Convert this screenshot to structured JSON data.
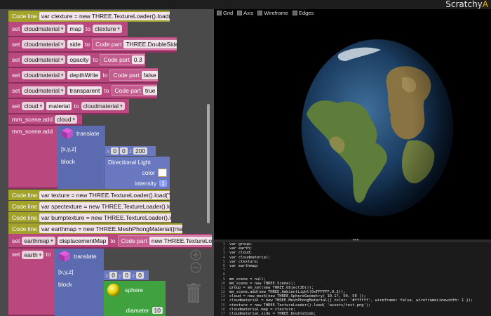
{
  "brand": {
    "name": "Scratchy",
    "accent": "A"
  },
  "blocks": {
    "codeline1": {
      "label": "Code line",
      "value": "var ctexture = new THREE.TextureLoader().load(\"..."
    },
    "set_map": {
      "set": "set",
      "obj": "cloudmaterial",
      "prop": "map",
      "to": "to",
      "val": "ctexture"
    },
    "set_side": {
      "set": "set",
      "obj": "cloudmaterial",
      "prop": "side",
      "to": "to",
      "code": "Code part",
      "val": "THREE.DoubleSide"
    },
    "set_opacity": {
      "set": "set",
      "obj": "cloudmaterial",
      "prop": "opacity",
      "to": "to",
      "code": "Code part",
      "val": "0.3"
    },
    "set_depth": {
      "set": "set",
      "obj": "cloudmaterial",
      "prop": "depthWrite",
      "to": "to",
      "code": "Code part",
      "val": "false"
    },
    "set_transparent": {
      "set": "set",
      "obj": "cloudmaterial",
      "prop": "transparent",
      "to": "to",
      "code": "Code part",
      "val": "true"
    },
    "set_cloud_material": {
      "set": "set",
      "obj": "cloud",
      "prop": "material",
      "to": "to",
      "val": "cloudmaterial"
    },
    "add_cloud": {
      "label": "mm_scene.add",
      "val": "cloud"
    },
    "add_light": {
      "label": "mm_scene.add",
      "translate": "translate",
      "xyz": "[x,y,z]",
      "x": "x",
      "xv": "0",
      "y": "y",
      "yv": "0",
      "z": "z",
      "zv": "200",
      "block": "block",
      "light": "Directional Light",
      "color": "color",
      "intensity": "intensity",
      "intensity_val": "1"
    },
    "codelines": [
      {
        "label": "Code line",
        "value": "var texture = new THREE.TextureLoader().load(\"a..."
      },
      {
        "label": "Code line",
        "value": "var spectexture = new THREE.TextureLoader().load..."
      },
      {
        "label": "Code line",
        "value": "var bumptexture = new THREE.TextureLoader().load..."
      },
      {
        "label": "Code line",
        "value": "var earthmap = new THREE.MeshPhongMaterial({map ..."
      }
    ],
    "set_earthmap": {
      "set": "set",
      "obj": "earthmap",
      "prop": "displacementMap",
      "to": "to",
      "code": "Code part",
      "val": "new THREE.TextureLoad"
    },
    "set_earth": {
      "set": "set",
      "obj": "earth",
      "to": "to",
      "translate": "translate",
      "xyz": "[x,y,z]",
      "x": "x",
      "xv": "0",
      "y": "y",
      "yv": "0",
      "z": "z",
      "zv": "0",
      "block": "block",
      "sphere": "sphere",
      "diameter": "diameter",
      "diameter_val": "10"
    }
  },
  "viewport": {
    "tabs": [
      {
        "label": "Grid"
      },
      {
        "label": "Axis"
      },
      {
        "label": "Wireframe"
      },
      {
        "label": "Edges"
      }
    ]
  },
  "editor": {
    "splitter": "•••",
    "lines": [
      "var group;",
      "var earth;",
      "var cloud;",
      "var cloudmaterial;",
      "var ctexture;",
      "var earthmap;",
      "",
      "",
      "mm_scene = null;",
      "mm_scene = new THREE.Scene();",
      "group = mm_set(new THREE.Object3D());",
      "mm_scene.add(new THREE.AmbientLight(0xFFFFFF,0.2));",
      "cloud = new_mesh(new THREE.SphereGeometry( 10.1?, 50, 50 ));",
      "cloudmaterial = new THREE.MeshPhongMaterial({ color: '#ffffff', wireframe: false, wireframeLinewidth: 1 });",
      "ctexture = new THREE.TextureLoader().load( 'assets/test.png');",
      "cloudmaterial.map = ctexture;",
      "cloudmaterial.side = THREE.DoubleSide;"
    ]
  }
}
